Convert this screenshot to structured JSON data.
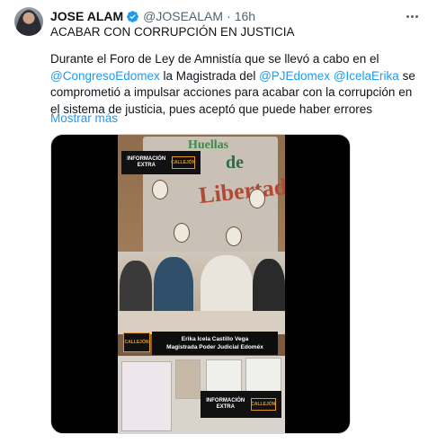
{
  "author": {
    "name": "JOSE ALAM",
    "handle": "@JOSEALAM",
    "separator": "·",
    "time": "16h"
  },
  "tweet": {
    "headline": "ACABAR CON CORRUPCIÓN EN JUSTICIA",
    "text_part1": "Durante el Foro de Ley de Amnistía que se llevó a cabo en el ",
    "mention1": "@CongresoEdomex",
    "text_part2": " la Magistrada del ",
    "mention2": "@PJEdomex",
    "text_part3": " ",
    "mention3": "@IcelaErika",
    "text_part4": " se comprometió a impulsar acciones para acabar con la corrupción en el sistema de justicia, pues aceptó que puede haber errores",
    "show_more": "Mostrar más"
  },
  "video": {
    "banner_word1": "Huellas",
    "banner_word2": "de",
    "banner_word3": "Libertad",
    "logo_line1": "INFORMACIÓN",
    "logo_line2": "EXTRA",
    "logo_brand": "CALLEJÓN",
    "caption_line1": "Erika Icela Castillo Vega",
    "caption_line2": "Magistrada Poder Judicial Edoméx"
  },
  "colors": {
    "link": "#1d9bf0",
    "secondary_text": "#536471",
    "verified": "#1d9bf0"
  },
  "icons": {
    "verified": "verified-badge-icon",
    "more": "more-options-icon"
  }
}
